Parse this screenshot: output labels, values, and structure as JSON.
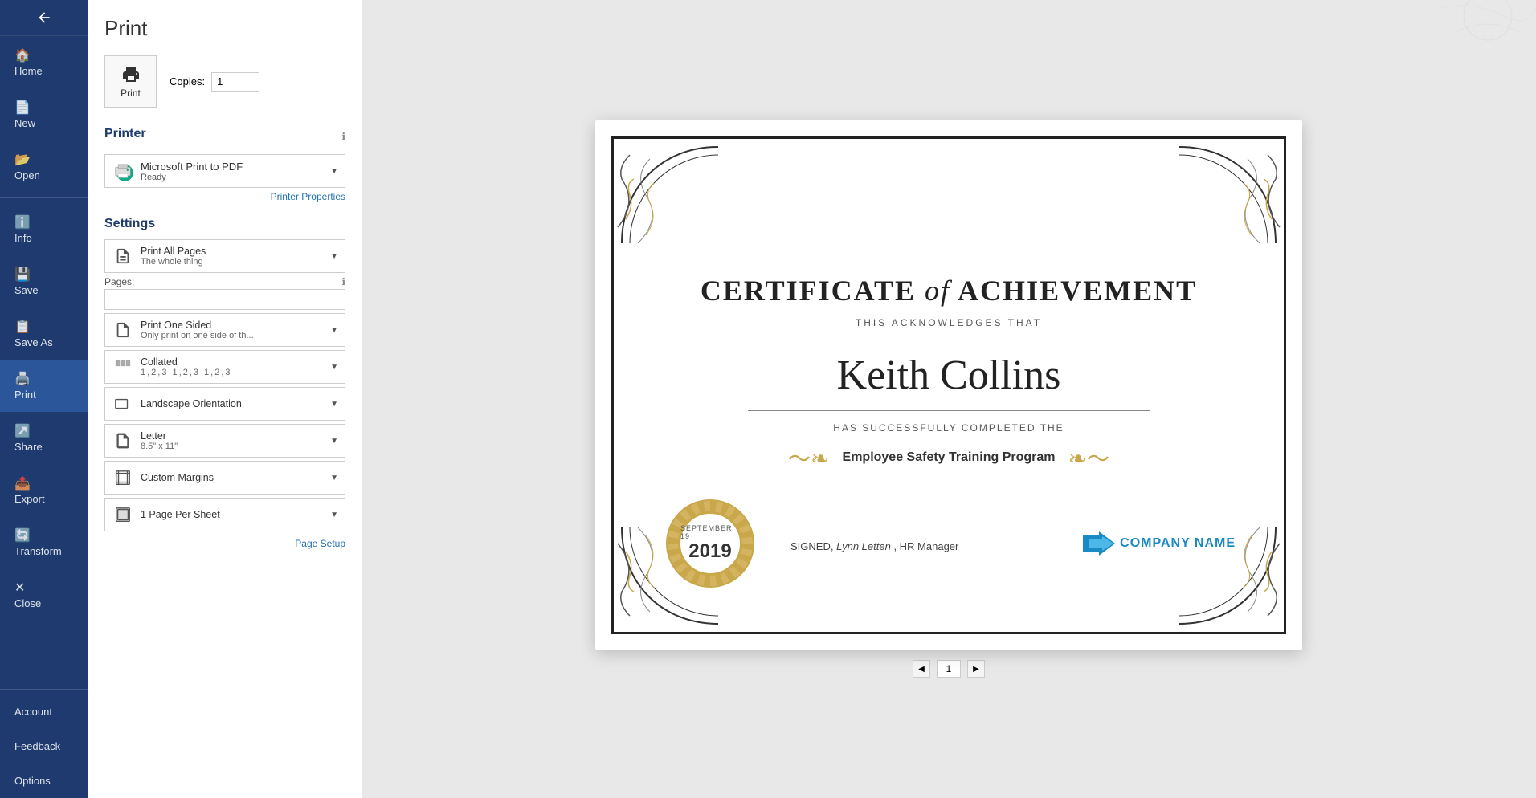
{
  "sidebar": {
    "items": [
      {
        "id": "back",
        "label": "",
        "icon": "back-arrow"
      },
      {
        "id": "home",
        "label": "Home",
        "icon": "home-icon"
      },
      {
        "id": "new",
        "label": "New",
        "icon": "new-icon"
      },
      {
        "id": "open",
        "label": "Open",
        "icon": "open-icon"
      },
      {
        "id": "info",
        "label": "Info",
        "icon": "info-icon"
      },
      {
        "id": "save",
        "label": "Save",
        "icon": "save-icon"
      },
      {
        "id": "save-as",
        "label": "Save As",
        "icon": "save-as-icon"
      },
      {
        "id": "print",
        "label": "Print",
        "icon": "print-icon",
        "active": true
      },
      {
        "id": "share",
        "label": "Share",
        "icon": "share-icon"
      },
      {
        "id": "export",
        "label": "Export",
        "icon": "export-icon"
      },
      {
        "id": "transform",
        "label": "Transform",
        "icon": "transform-icon"
      },
      {
        "id": "close",
        "label": "Close",
        "icon": "close-icon"
      }
    ],
    "bottom_items": [
      {
        "id": "account",
        "label": "Account"
      },
      {
        "id": "feedback",
        "label": "Feedback"
      },
      {
        "id": "options",
        "label": "Options"
      }
    ]
  },
  "print_panel": {
    "title": "Print",
    "copies_label": "Copies:",
    "copies_value": "1",
    "print_button_label": "Print",
    "printer_section_label": "Printer",
    "info_tooltip": "ℹ",
    "printer_name": "Microsoft Print to PDF",
    "printer_status": "Ready",
    "printer_properties_label": "Printer Properties",
    "settings_section_label": "Settings",
    "settings": [
      {
        "id": "print-range",
        "main": "Print All Pages",
        "sub": "The whole thing",
        "icon": "pages-icon"
      },
      {
        "id": "sides",
        "main": "Print One Sided",
        "sub": "Only print on one side of th...",
        "icon": "one-sided-icon"
      },
      {
        "id": "collate",
        "main": "Collated",
        "sub": "1,2,3   1,2,3   1,2,3",
        "icon": "collated-icon"
      },
      {
        "id": "orientation",
        "main": "Landscape Orientation",
        "sub": "",
        "icon": "orientation-icon"
      },
      {
        "id": "paper-size",
        "main": "Letter",
        "sub": "8.5\" x 11\"",
        "icon": "paper-icon"
      },
      {
        "id": "margins",
        "main": "Custom Margins",
        "sub": "",
        "icon": "margins-icon"
      },
      {
        "id": "pages-per-sheet",
        "main": "1 Page Per Sheet",
        "sub": "",
        "icon": "per-sheet-icon"
      }
    ],
    "pages_label": "Pages:",
    "pages_placeholder": "",
    "page_setup_label": "Page Setup"
  },
  "certificate": {
    "title_part1": "CERTIFICATE ",
    "title_italic": "of",
    "title_part2": " ACHIEVEMENT",
    "acknowledges": "THIS ACKNOWLEDGES THAT",
    "recipient_name": "Keith Collins",
    "completed_text": "HAS SUCCESSFULLY COMPLETED THE",
    "program_name": "Employee Safety Training Program",
    "seal_month": "SEPTEMBER 19",
    "seal_year": "2019",
    "signature_text": "SIGNED,",
    "signer_name": "Lynn Letten",
    "signer_title": ", HR Manager",
    "company_name": "COMPANY NAME"
  },
  "preview_nav": {
    "page_num": "1",
    "total_pages": "1"
  }
}
